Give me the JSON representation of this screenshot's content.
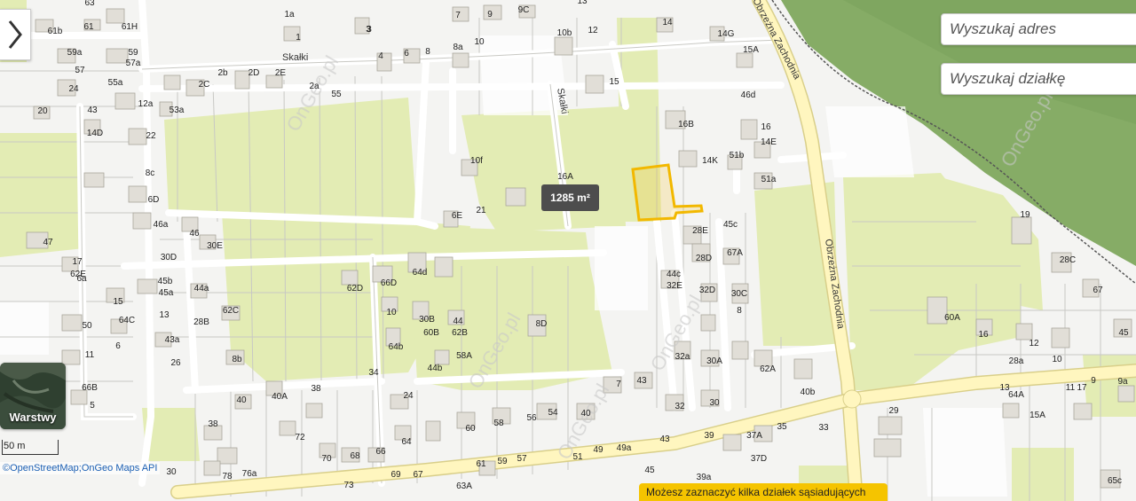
{
  "map": {
    "streets": [
      "Skałki",
      "Skałki",
      "Obrzeżna Zachodnia",
      "Obrzeżna Zachodnia"
    ],
    "house_numbers": [
      "63",
      "3",
      "9",
      "9C",
      "13",
      "61b",
      "61",
      "61H",
      "1a",
      "1",
      "3",
      "7",
      "10b",
      "12",
      "14",
      "14G",
      "59a",
      "59",
      "57",
      "57a",
      "8",
      "8a",
      "10",
      "4",
      "6",
      "15A",
      "55a",
      "24",
      "2b",
      "2C",
      "2D",
      "2E",
      "2a",
      "55",
      "12a",
      "15",
      "46d",
      "53a",
      "22",
      "43",
      "20",
      "14D",
      "16B",
      "16",
      "14E",
      "14K",
      "51b",
      "8c",
      "10f",
      "16A",
      "51a",
      "6D",
      "6E",
      "21",
      "47",
      "46a",
      "46",
      "30E",
      "28E",
      "45c",
      "30D",
      "28D",
      "67A",
      "19",
      "17",
      "62E",
      "64d",
      "66D",
      "62D",
      "45b",
      "44a",
      "45a",
      "44c",
      "32E",
      "32D",
      "30C",
      "28C",
      "67",
      "6a",
      "15",
      "10",
      "64C",
      "8",
      "28B",
      "30B",
      "44",
      "62C",
      "60B",
      "62B",
      "60A",
      "16",
      "12",
      "8D",
      "50",
      "13",
      "45",
      "11",
      "64b",
      "58A",
      "6",
      "32a",
      "30A",
      "43a",
      "28a",
      "10",
      "8b",
      "44b",
      "62A",
      "26",
      "43",
      "34",
      "66B",
      "7",
      "38",
      "40b",
      "24",
      "64A",
      "17",
      "9",
      "9a",
      "40A",
      "32",
      "30",
      "5",
      "40",
      "13",
      "11",
      "29",
      "15A",
      "38",
      "56",
      "54",
      "40",
      "72",
      "64",
      "60",
      "58",
      "35",
      "33",
      "37A",
      "49a",
      "43",
      "39",
      "66",
      "70",
      "68",
      "51",
      "49",
      "37D",
      "45",
      "61",
      "59",
      "57",
      "39a",
      "76a",
      "78",
      "30",
      "69",
      "67",
      "73",
      "63A",
      "65c"
    ]
  },
  "ui": {
    "expand_icon": "chevron-right-icon",
    "search_address_placeholder": "Wyszukaj adres",
    "search_parcel_placeholder": "Wyszukaj działkę",
    "layers_label": "Warstwy",
    "scale_label": "50 m",
    "attribution": {
      "osm": "©OpenStreetMap",
      "separator": ";",
      "ongeo": "OnGeo Maps API"
    },
    "area_label": "1285 m²",
    "notice_text": "Możesz zaznaczyć kilka działek sąsiadujących",
    "watermark": "OnGeo.pl"
  },
  "colors": {
    "parcel_highlight": "#f2b800",
    "vegetation": "#e2ecb2",
    "forest": "#7fa860",
    "road": "#fff3b0",
    "building": "#dedad2"
  }
}
